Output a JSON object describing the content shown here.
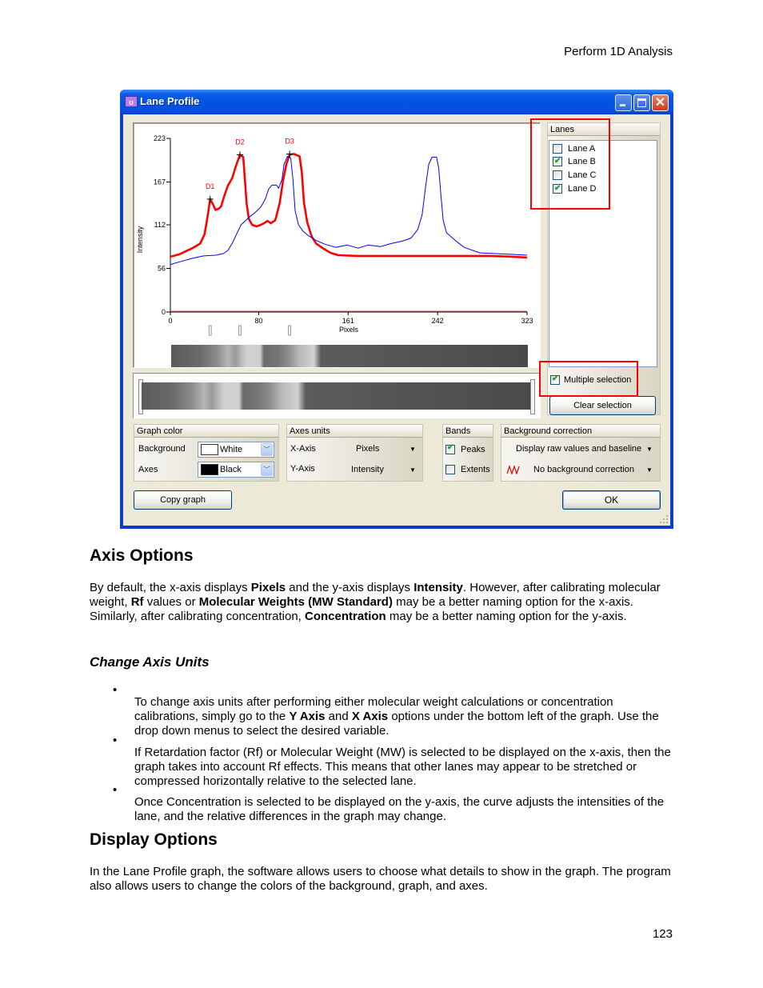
{
  "page": {
    "header": "Perform 1D Analysis",
    "page_number": "123"
  },
  "window": {
    "title": "Lane Profile",
    "icon": "app-logo-icon",
    "controls": {
      "minimize": "minimize-icon",
      "maximize": "maximize-icon",
      "close": "close-icon",
      "close_glyph": "✕"
    }
  },
  "graph": {
    "y_label": "Intensity",
    "x_label": "Pixels",
    "y_ticks": [
      "0",
      "56",
      "112",
      "167",
      "223"
    ],
    "x_ticks": [
      "0",
      "80",
      "161",
      "242",
      "323"
    ],
    "peak_labels": [
      "D1",
      "D2",
      "D3"
    ]
  },
  "chart_data": {
    "type": "line",
    "title": "Lane Profile",
    "xlabel": "Pixels",
    "ylabel": "Intensity",
    "xlim": [
      0,
      323
    ],
    "ylim": [
      0,
      223
    ],
    "x_ticks": [
      0,
      80,
      161,
      242,
      323
    ],
    "y_ticks": [
      0,
      56,
      112,
      167,
      223
    ],
    "grid": false,
    "series": [
      {
        "name": "Lane B",
        "color": "#ff0000",
        "points": [
          [
            0,
            71
          ],
          [
            8,
            74
          ],
          [
            14,
            78
          ],
          [
            20,
            82
          ],
          [
            27,
            88
          ],
          [
            31,
            100
          ],
          [
            34,
            125
          ],
          [
            36,
            145
          ],
          [
            38,
            140
          ],
          [
            41,
            131
          ],
          [
            44,
            133
          ],
          [
            46,
            136
          ],
          [
            49,
            150
          ],
          [
            52,
            162
          ],
          [
            56,
            172
          ],
          [
            59,
            186
          ],
          [
            62,
            198
          ],
          [
            63,
            202
          ],
          [
            66,
            199
          ],
          [
            67,
            180
          ],
          [
            69,
            140
          ],
          [
            71,
            120
          ],
          [
            74,
            112
          ],
          [
            78,
            110
          ],
          [
            82,
            112
          ],
          [
            86,
            115
          ],
          [
            88,
            117
          ],
          [
            91,
            114
          ],
          [
            95,
            118
          ],
          [
            99,
            140
          ],
          [
            102,
            168
          ],
          [
            105,
            190
          ],
          [
            108,
            202
          ],
          [
            112,
            203
          ],
          [
            117,
            200
          ],
          [
            119,
            180
          ],
          [
            121,
            140
          ],
          [
            124,
            115
          ],
          [
            128,
            97
          ],
          [
            132,
            88
          ],
          [
            138,
            82
          ],
          [
            145,
            76
          ],
          [
            152,
            73
          ],
          [
            170,
            72
          ],
          [
            200,
            72
          ],
          [
            230,
            72
          ],
          [
            260,
            72
          ],
          [
            290,
            72
          ],
          [
            310,
            71
          ],
          [
            323,
            70
          ]
        ]
      },
      {
        "name": "Lane D",
        "color": "#0000ff",
        "points": [
          [
            0,
            61
          ],
          [
            10,
            65
          ],
          [
            20,
            69
          ],
          [
            30,
            72
          ],
          [
            41,
            73
          ],
          [
            48,
            75
          ],
          [
            52,
            79
          ],
          [
            56,
            88
          ],
          [
            60,
            100
          ],
          [
            64,
            112
          ],
          [
            70,
            120
          ],
          [
            77,
            128
          ],
          [
            82,
            135
          ],
          [
            86,
            145
          ],
          [
            89,
            158
          ],
          [
            92,
            163
          ],
          [
            96,
            163
          ],
          [
            98,
            159
          ],
          [
            101,
            170
          ],
          [
            103,
            190
          ],
          [
            106,
            200
          ],
          [
            109,
            198
          ],
          [
            111,
            170
          ],
          [
            113,
            130
          ],
          [
            116,
            112
          ],
          [
            120,
            104
          ],
          [
            125,
            98
          ],
          [
            132,
            92
          ],
          [
            140,
            87
          ],
          [
            150,
            83
          ],
          [
            160,
            86
          ],
          [
            170,
            82
          ],
          [
            179,
            86
          ],
          [
            190,
            84
          ],
          [
            200,
            88
          ],
          [
            210,
            91
          ],
          [
            218,
            95
          ],
          [
            224,
            106
          ],
          [
            228,
            125
          ],
          [
            231,
            160
          ],
          [
            234,
            190
          ],
          [
            237,
            199
          ],
          [
            241,
            199
          ],
          [
            243,
            185
          ],
          [
            245,
            150
          ],
          [
            247,
            118
          ],
          [
            250,
            102
          ],
          [
            258,
            92
          ],
          [
            266,
            83
          ],
          [
            280,
            76
          ],
          [
            295,
            75
          ],
          [
            310,
            74
          ],
          [
            323,
            73
          ]
        ]
      },
      {
        "name": "baseline",
        "color": "#ff6060",
        "points": [
          [
            0,
            1
          ],
          [
            323,
            1
          ]
        ]
      }
    ],
    "peaks": [
      {
        "label": "D1",
        "x": 36,
        "y": 145
      },
      {
        "label": "D2",
        "x": 63,
        "y": 202
      },
      {
        "label": "D3",
        "x": 108,
        "y": 203
      }
    ]
  },
  "lanes_panel": {
    "title": "Lanes",
    "items": [
      {
        "label": "Lane A",
        "checked": false
      },
      {
        "label": "Lane B",
        "checked": true
      },
      {
        "label": "Lane C",
        "checked": false
      },
      {
        "label": "Lane D",
        "checked": true
      }
    ],
    "multiple_selection": {
      "label": "Multiple selection",
      "checked": true
    },
    "clear_button": "Clear selection"
  },
  "graph_color": {
    "title": "Graph color",
    "background_label": "Background",
    "background_value": "White",
    "background_swatch": "#ffffff",
    "axes_label": "Axes",
    "axes_value": "Black",
    "axes_swatch": "#000000"
  },
  "axes_units": {
    "title": "Axes units",
    "x_label": "X-Axis",
    "x_value": "Pixels",
    "y_label": "Y-Axis",
    "y_value": "Intensity"
  },
  "bands": {
    "title": "Bands",
    "peaks": {
      "label": "Peaks",
      "checked": true
    },
    "extents": {
      "label": "Extents",
      "checked": false
    }
  },
  "background_correction": {
    "title": "Background correction",
    "display_value": "Display raw values and baseline",
    "correction_value": "No background correction",
    "correction_icon": "wave-icon"
  },
  "buttons": {
    "copy_graph": "Copy graph",
    "ok": "OK"
  },
  "annotations": {
    "highlight_color": "#ff0000"
  },
  "doc": {
    "axis_options_heading": "Axis Options",
    "axis_para": [
      {
        "t": "By default, the x-axis displays ",
        "b": false
      },
      {
        "t": "Pixels",
        "b": true
      },
      {
        "t": " and the y-axis displays ",
        "b": false
      },
      {
        "t": "Intensity",
        "b": true
      },
      {
        "t": ". However, after calibrating molecular weight, ",
        "b": false
      },
      {
        "t": "Rf",
        "b": true
      },
      {
        "t": " values or ",
        "b": false
      },
      {
        "t": "Molecular Weights (MW Standard)",
        "b": true
      },
      {
        "t": " may be a better naming option for the x-axis. Similarly, after calibrating concentration, ",
        "b": false
      },
      {
        "t": "Concentration",
        "b": true
      },
      {
        "t": " may be a better naming option for the y-axis.",
        "b": false
      }
    ],
    "change_axis_heading": "Change Axis Units",
    "bullets": [
      [
        {
          "t": "To change axis units after performing either molecular weight calculations or concentration calibrations, simply go to the ",
          "b": false
        },
        {
          "t": "Y Axis",
          "b": true
        },
        {
          "t": " and ",
          "b": false
        },
        {
          "t": "X Axis",
          "b": true
        },
        {
          "t": " options under the bottom left of the graph. Use the drop down menus to select the desired variable.",
          "b": false
        }
      ],
      [
        {
          "t": "If Retardation factor (Rf) or Molecular Weight (MW) is selected to be displayed on the x-axis, then the graph takes into account Rf effects. This means that other lanes may appear to be stretched or compressed horizontally relative to the selected lane.",
          "b": false
        }
      ],
      [
        {
          "t": "Once Concentration is selected to be displayed on the y-axis, the curve adjusts the intensities of the lane, and the relative differences in the graph may change.",
          "b": false
        }
      ]
    ],
    "display_options_heading": "Display Options",
    "display_para": "In the Lane Profile graph, the software allows users to choose what details to show in the graph. The program also allows users to change the colors of the background, graph, and axes."
  }
}
